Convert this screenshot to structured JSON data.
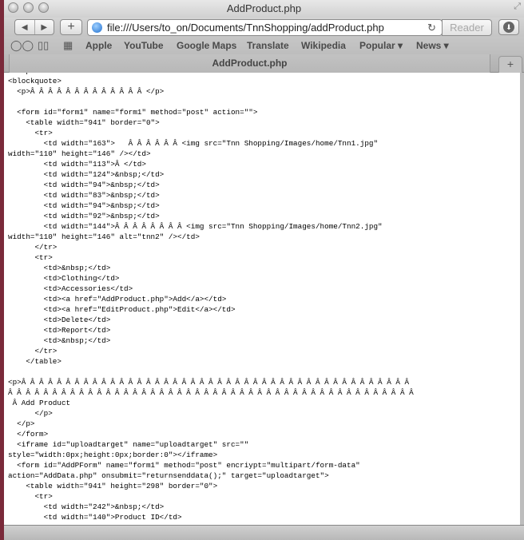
{
  "window": {
    "title": "AddProduct.php",
    "fullscreen_icon": "fullscreen-arrows-icon"
  },
  "toolbar": {
    "back_icon": "◀",
    "forward_icon": "▶",
    "add_label": "+",
    "url": "file:///Users/to_on/Documents/TnnShopping/addProduct.php",
    "reload_icon": "↻",
    "reader_label": "Reader",
    "download_icon": "⬇"
  },
  "bookmarks": {
    "reading_list_icon": "○○",
    "bookmarks_icon": "📖",
    "top_sites_icon": "▦",
    "items": [
      "Apple",
      "YouTube",
      "Google Maps",
      "Translate",
      "Wikipedia",
      "Popular ▾",
      "News ▾"
    ]
  },
  "tabs": {
    "active": "AddProduct.php",
    "new_tab_label": "+"
  },
  "code": {
    "lines": [
      "  </p>",
      "<blockquote>",
      "  <p>Â Â Â Â Â Â Â Â Â Â Â Â Â </p>",
      "",
      "  <form id=\"form1\" name=\"form1\" method=\"post\" action=\"\">",
      "    <table width=\"941\" border=\"0\">",
      "      <tr>",
      "        <td width=\"163\">   Â Â Â Â Â Â <img src=\"Tnn Shopping/Images/home/Tnn1.jpg\"",
      "width=\"110\" height=\"146\" /></td>",
      "        <td width=\"113\">Â </td>",
      "        <td width=\"124\">&nbsp;</td>",
      "        <td width=\"94\">&nbsp;</td>",
      "        <td width=\"83\">&nbsp;</td>",
      "        <td width=\"94\">&nbsp;</td>",
      "        <td width=\"92\">&nbsp;</td>",
      "        <td width=\"144\">Â Â Â Â Â Â Â Â <img src=\"Tnn Shopping/Images/home/Tnn2.jpg\"",
      "width=\"110\" height=\"146\" alt=\"tnn2\" /></td>",
      "      </tr>",
      "      <tr>",
      "        <td>&nbsp;</td>",
      "        <td>Clothing</td>",
      "        <td>Accessories</td>",
      "        <td><a href=\"AddProduct.php\">Add</a></td>",
      "        <td><a href=\"EditProduct.php\">Edit</a></td>",
      "        <td>Delete</td>",
      "        <td>Report</td>",
      "        <td>&nbsp;</td>",
      "      </tr>",
      "    </table>",
      "",
      "<p>Â Â Â Â Â Â Â Â Â Â Â Â Â Â Â Â Â Â Â Â Â Â Â Â Â Â Â Â Â Â Â Â Â Â Â Â Â Â Â Â Â Â Â Â",
      "Â Â Â Â Â Â Â Â Â Â Â Â Â Â Â Â Â Â Â Â Â Â Â Â Â Â Â Â Â Â Â Â Â Â Â Â Â Â Â Â Â Â Â Â Â Â",
      " Â Add Product",
      "      </p>",
      "  </p>",
      "  </form>",
      "  <iframe id=\"uploadtarget\" name=\"uploadtarget\" src=\"\"",
      "style=\"width:0px;height:0px;border:0\"></iframe>",
      "  <form id=\"AddPForm\" name=\"form1\" method=\"post\" encriypt=\"multipart/form-data\"",
      "action=\"AddData.php\" onsubmit=\"returnsenddata();\" target=\"uploadtarget\">",
      "    <table width=\"941\" height=\"298\" border=\"0\">",
      "      <tr>",
      "        <td width=\"242\">&nbsp;</td>",
      "        <td width=\"140\">Product ID</td>"
    ]
  }
}
